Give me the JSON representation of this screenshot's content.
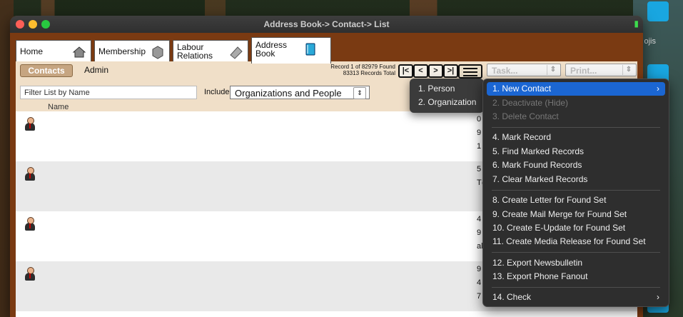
{
  "window": {
    "title": "Address Book-> Contact-> List"
  },
  "tabs": [
    {
      "label": "Home"
    },
    {
      "label": "Membership"
    },
    {
      "label": "Labour\nRelations"
    },
    {
      "label": "Address\nBook"
    }
  ],
  "toolbar": {
    "contacts_label": "Contacts",
    "admin_label": "Admin",
    "record_line1": "Record 1 of 82979 Found",
    "record_line2": "83313 Records Total",
    "nav": {
      "first": "|<",
      "prev": "<",
      "next": ">",
      "last": ">|"
    },
    "task_label": "Task...",
    "print_label": "Print..."
  },
  "filter": {
    "placeholder": "Filter List by Name",
    "include_label": "Include",
    "include_value": "Organizations and People",
    "name_header": "Name"
  },
  "rows": [
    {
      "peek": [
        "0",
        "9",
        "1"
      ]
    },
    {
      "peek": [
        "5",
        "T@"
      ]
    },
    {
      "peek": [
        "4",
        "9",
        "al"
      ]
    },
    {
      "peek": [
        "9",
        "4",
        "7"
      ]
    }
  ],
  "submenu": {
    "items": [
      "1. Person",
      "2. Organization"
    ]
  },
  "menu": {
    "items": [
      "1. New Contact",
      "2. Deactivate (Hide)",
      "3. Delete Contact",
      "4. Mark Record",
      "5. Find Marked Records",
      "6. Mark Found Records",
      "7. Clear Marked Records",
      "8. Create Letter for Found Set",
      "9. Create Mail Merge for Found Set",
      "10. Create E-Update for Found Set",
      "11. Create Media Release for Found Set",
      "12. Export Newsbulletin",
      "13. Export Phone Fanout",
      "14. Check"
    ],
    "chevron": "›"
  },
  "desktop": {
    "emoji_text": "ojis"
  },
  "colors": {
    "window_frame": "#7a3a12",
    "highlight": "#1b66d2",
    "toolbar_bg": "#f0dfc8"
  }
}
